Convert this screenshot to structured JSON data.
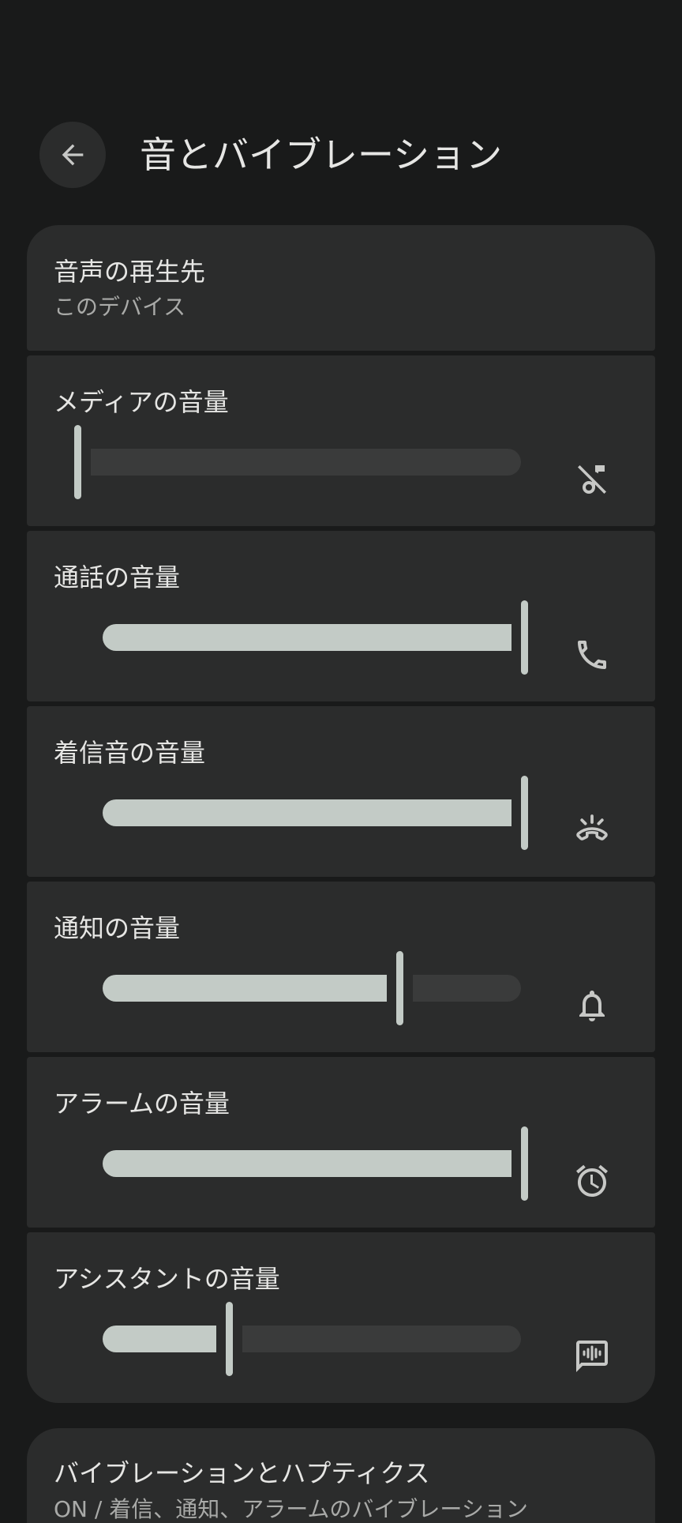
{
  "header": {
    "title": "音とバイブレーション"
  },
  "output": {
    "title": "音声の再生先",
    "subtitle": "このデバイス"
  },
  "volumes": [
    {
      "label": "メディアの音量",
      "level": 0.0,
      "icon": "music-off-icon"
    },
    {
      "label": "通話の音量",
      "level": 1.0,
      "icon": "phone-icon"
    },
    {
      "label": "着信音の音量",
      "level": 1.0,
      "icon": "ring-volume-icon"
    },
    {
      "label": "通知の音量",
      "level": 0.72,
      "icon": "bell-icon"
    },
    {
      "label": "アラームの音量",
      "level": 1.0,
      "icon": "alarm-icon"
    },
    {
      "label": "アシスタントの音量",
      "level": 0.34,
      "icon": "voice-chat-icon"
    }
  ],
  "vibration": {
    "title": "バイブレーションとハプティクス",
    "subtitle": "ON / 着信、通知、アラームのバイブレーション"
  },
  "colors": {
    "background": "#191a1a",
    "card": "#2b2c2c",
    "accent": "#c3cbc6"
  }
}
